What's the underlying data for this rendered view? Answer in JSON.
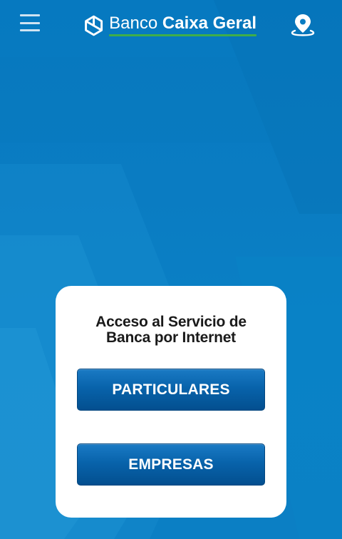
{
  "header": {
    "menu_icon": "hamburger-menu-icon",
    "logo": {
      "brand_light": "Banco",
      "brand_bold": "Caixa Geral",
      "mark_icon": "caixa-geral-logo-icon"
    },
    "location_icon": "map-pin-icon"
  },
  "card": {
    "title_line1": "Acceso al Servicio de",
    "title_line2": "Banca por Internet",
    "buttons": {
      "particulares": "PARTICULARES",
      "empresas": "EMPRESAS"
    }
  },
  "colors": {
    "background": "#0a7cc2",
    "button": "#0863ab",
    "logo_underline": "#3fae49",
    "card": "#ffffff"
  }
}
